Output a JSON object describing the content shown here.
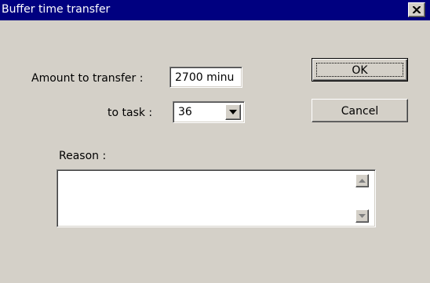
{
  "window": {
    "title": "Buffer time transfer"
  },
  "form": {
    "amount_label": "Amount to transfer :",
    "amount_value": "2700 minu",
    "task_label": "to task :",
    "task_selected": "36",
    "reason_label": "Reason :",
    "reason_value": ""
  },
  "buttons": {
    "ok": "OK",
    "cancel": "Cancel"
  },
  "icons": {
    "close": "close-icon",
    "dropdown": "chevron-down-icon",
    "scroll_up": "scroll-up-arrow-icon",
    "scroll_down": "scroll-down-arrow-icon"
  },
  "colors": {
    "titlebar": "#000080",
    "dialog_face": "#d4d0c8"
  }
}
